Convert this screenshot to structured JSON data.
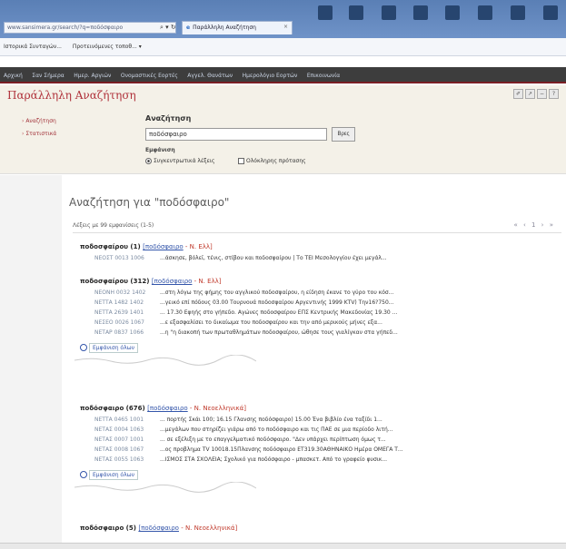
{
  "browser": {
    "address": "www.sansimera.gr/search/?q=ποδόσφαιρο",
    "address_icons": "⌕ ▾ ↻",
    "tab_icon": "e",
    "tab_title": "Παράλληλη Αναζήτηση",
    "tab_close": "×",
    "favorites": [
      "Ιστορικά Συνταγών...",
      "Προτεινόμενες τοποθ... ▾"
    ]
  },
  "nav": {
    "items": [
      "Αρχική",
      "Σαν Σήμερα",
      "Ημερ. Αργιών",
      "Ονομαστικές Εορτές",
      "Αγγελ. Θανάτων",
      "Ημερολόγιο Εορτών",
      "Επικοινωνία"
    ]
  },
  "panel": {
    "title": "Παράλληλη Αναζήτηση",
    "tools": [
      "✐",
      "↗",
      "−",
      "?"
    ],
    "side_links": [
      "Αναζήτηση",
      "Στατιστικά"
    ],
    "search_label": "Αναζήτηση",
    "search_value": "ποδόσφαιρο",
    "search_button": "Βρες",
    "results_label": "Εμφάνιση",
    "option1": "Συγκεντρωτικά λέξεις",
    "option2": "Ολόκληρης πρότασης"
  },
  "results": {
    "heading": "Αναζήτηση για \"ποδόσφαιρο\"",
    "count": "Λέξεις με 99 εμφανίσεις (1-5)",
    "pager": "« ‹ 1 › »",
    "groups": [
      {
        "word": "ποδοσφαίρου (1)",
        "link": "[ποδόσφαιρο",
        "source": " - Ν. Ελλ]",
        "rows": [
          {
            "ref": "ΝΕΟΣΤ 0013 1006",
            "text": "...άσκησε, βόλεϊ, τένις, στίβου και ποδοσφαίρου | Το ΤΕΙ Μεσολογγίου έχει μεγάλ..."
          }
        ]
      },
      {
        "word": "ποδοσφαίρου (312)",
        "link": "[ποδόσφαιρο",
        "source": " - Ν. Ελλ]",
        "rows": [
          {
            "ref": "ΝΕΟΝΗ 0032 1402",
            "text": "...στη λόγω της φήμης του αγγλικού ποδοσφαίρου, η είδηση έκανε το γύρο του κόσ..."
          },
          {
            "ref": "ΝΕΤΤΑ 1482 1402",
            "text": "...γεικό επί πόδους 03.00 Τουρνουά ποδοσφαίρου Αργεντινής 1999 ΚΤV) Την16?750..."
          },
          {
            "ref": "ΝΕΤΤΑ 2639 1401",
            "text": "... 17.30 Εφηής στο γήπεδο. Αγώνες ποδοσφαίρου ΕΠΣ Κεντρικής Μακεδονίας 19.30 ..."
          },
          {
            "ref": "ΝΕΣΕΟ 0026 1067",
            "text": "...ε εξασφαλίσει το δικαίωμα του ποδοσφαίρου και την από μερικούς μήνες εξα..."
          },
          {
            "ref": "ΝΕΤΑΡ 0837 1066",
            "text": "...η \"η διακοπή των πρωταθλημάτων ποδοσφαίρου, ώθησε τους γιαλίγκαν στα γήπεδ..."
          }
        ],
        "more": "Εμφάνιση όλων"
      },
      {
        "word": "ποδόσφαιρο (676)",
        "link": "[ποδόσφαιρο",
        "source": " - Ν. Νεοελληνικά]",
        "rows": [
          {
            "ref": "ΝΕΤΤΑ 0465 1001",
            "text": "... πορτής Σκάι 100; 16.15 Γλανσης ποδόσφαιρο) 15.00 Ένα βιβλίο ένα ταξίδι 1..."
          },
          {
            "ref": "ΝΕΤΑΣ 0004 1063",
            "text": "...μεγάλων που στηρίζει γιάρω από το ποδόσφαιρο και τις ΠΑΕ σε μια περίοδο λιτή..."
          },
          {
            "ref": "ΝΕΤΑΣ 0007 1001",
            "text": "... σε εξέλιξη με το επαγγελματικό ποδόσφαιρο. \"Δεν υπάρχει περίπτωση όμως τ..."
          },
          {
            "ref": "ΝΕΤΑΣ 0008 1067",
            "text": "...ος προβλημα ΤV 10018.15Πλανσης ποδόσφαιρο ΕΤ319.30ΑΘΗΝΑΙΚΟ Ημέρα ΟΜΕΓΑ Τ..."
          },
          {
            "ref": "ΝΕΤΑΣ 0055 1063",
            "text": "...ΙΣΜΟΣ ΣΤΑ ΣΧΟΛΕΙΑ; Σχολικό για ποδόσφαιρο - μπασκετ. Από το γραφείο φυσικ..."
          }
        ],
        "more": "Εμφάνιση όλων"
      },
      {
        "word": "ποδόσφαιρο (5)",
        "link": "[ποδόσφαιρο",
        "source": " - Ν. Νεοελληνικά]",
        "rows": []
      }
    ]
  }
}
